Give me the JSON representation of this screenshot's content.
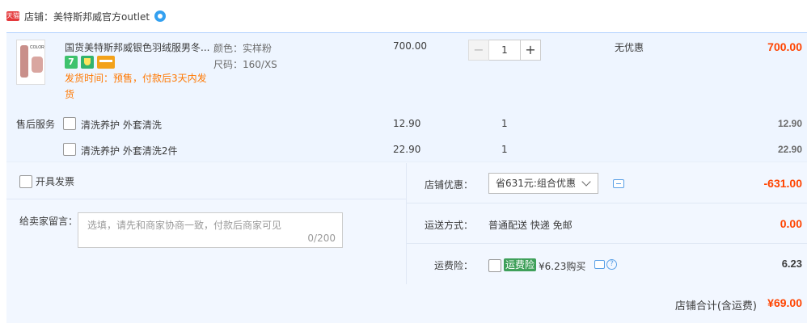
{
  "shop": {
    "badge": "天猫",
    "label": "店铺：美特斯邦威官方outlet",
    "icon": "wangwang-chat-icon"
  },
  "item": {
    "title": "国货美特斯邦威银色羽绒服男冬...",
    "thumb_logo": "COLOR",
    "badges": [
      "7-day-return-icon",
      "guarantee-shield-icon",
      "card-payment-icon"
    ],
    "badge_7": "7",
    "delivery": "发货时间：预售，付款后3天内发货",
    "sku_color": "颜色：实样粉",
    "sku_size": "尺码：160/XS",
    "price": "700.00",
    "qty": "1",
    "minus": "−",
    "plus": "+",
    "promo": "无优惠",
    "subtotal": "700.00"
  },
  "services": {
    "label": "售后服务",
    "rows": [
      {
        "name": "清洗养护 外套清洗",
        "price": "12.90",
        "qty": "1",
        "total": "12.90"
      },
      {
        "name": "清洗养护 外套清洗2件",
        "price": "22.90",
        "qty": "1",
        "total": "22.90"
      }
    ]
  },
  "left": {
    "invoice": "开具发票",
    "msg_label": "给卖家留言：",
    "msg_placeholder": "选填，请先和商家协商一致，付款后商家可见",
    "msg_count": "0/200"
  },
  "right": {
    "discount_label": "店铺优惠：",
    "discount_select": "省631元:组合优惠",
    "discount_amount": "-631.00",
    "shipping_label": "运送方式：",
    "shipping_text": "普通配送 快递 免邮",
    "shipping_amount": "0.00",
    "insurance_label": "运费险：",
    "insurance_badge": "运费险",
    "insurance_text": "¥6.23购买",
    "insurance_help": "?",
    "insurance_amount": "6.23"
  },
  "footer": {
    "label": "店铺合计(含运费)",
    "amount": "¥69.00"
  },
  "colors": {
    "price_red": "#ff4400",
    "delivery_orange": "#ff7800",
    "panel_blue": "#f2f7ff",
    "item_blue": "#eef5ff",
    "insurance_green": "#3fa05a"
  }
}
